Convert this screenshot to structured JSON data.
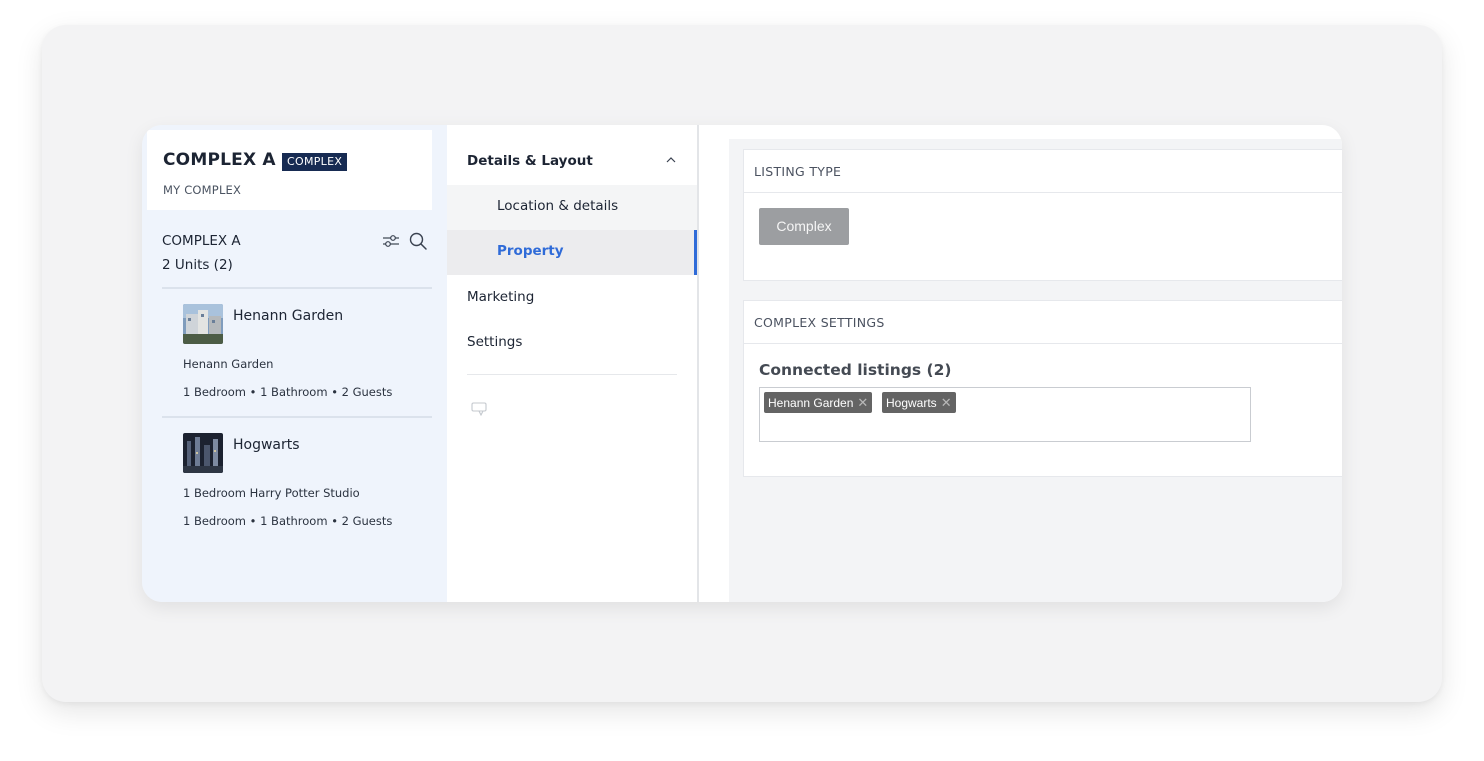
{
  "complex": {
    "title": "COMPLEX A",
    "badge": "COMPLEX",
    "subtitle": "MY COMPLEX"
  },
  "unit_list": {
    "heading": "COMPLEX A",
    "count": "2 Units (2)",
    "units": [
      {
        "name": "Henann Garden",
        "description": "Henann Garden",
        "specs": "1 Bedroom • 1 Bathroom • 2 Guests"
      },
      {
        "name": "Hogwarts",
        "description": "1 Bedroom Harry Potter Studio",
        "specs": "1 Bedroom • 1 Bathroom • 2 Guests"
      }
    ]
  },
  "nav": {
    "group_label": "Details & Layout",
    "sub_items": [
      "Location & details",
      "Property"
    ],
    "active_item": "Property",
    "items": [
      "Marketing",
      "Settings"
    ]
  },
  "listing_type": {
    "header": "LISTING TYPE",
    "button": "Complex"
  },
  "complex_settings": {
    "header": "COMPLEX SETTINGS",
    "connected_title": "Connected listings (2)",
    "tags": [
      "Henann Garden",
      "Hogwarts"
    ],
    "remove_glyph": "✕"
  },
  "colors": {
    "accent": "#2f6bd8",
    "badge_bg": "#172b52",
    "tag_bg": "#646464",
    "type_button_bg": "#9c9ea1"
  }
}
